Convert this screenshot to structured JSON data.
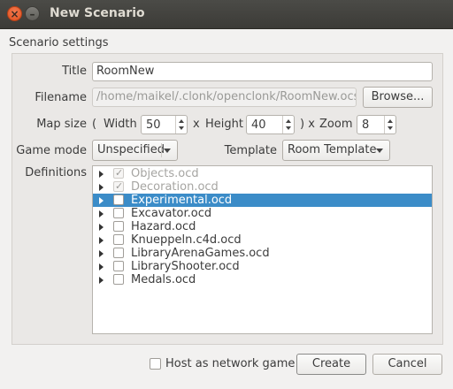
{
  "window": {
    "title": "New Scenario"
  },
  "group": {
    "label": "Scenario settings"
  },
  "form": {
    "title_label": "Title",
    "title_value": "RoomNew",
    "filename_label": "Filename",
    "filename_value": "/home/maikel/.clonk/openclonk/RoomNew.ocs",
    "browse_label": "Browse...",
    "mapsize_label": "Map size",
    "paren_open": "(",
    "width_label": "Width",
    "width_value": "50",
    "x_label": "x",
    "height_label": "Height",
    "height_value": "40",
    "paren_close_x": ") x",
    "zoom_label": "Zoom",
    "zoom_value": "8",
    "gamemode_label": "Game mode",
    "gamemode_value": "Unspecified",
    "template_label": "Template",
    "template_value": "Room Template",
    "definitions_label": "Definitions"
  },
  "definitions": [
    {
      "label": "Objects.ocd",
      "checked": true,
      "disabled": true,
      "selected": false
    },
    {
      "label": "Decoration.ocd",
      "checked": true,
      "disabled": true,
      "selected": false
    },
    {
      "label": "Experimental.ocd",
      "checked": false,
      "disabled": false,
      "selected": true
    },
    {
      "label": "Excavator.ocd",
      "checked": false,
      "disabled": false,
      "selected": false
    },
    {
      "label": "Hazard.ocd",
      "checked": false,
      "disabled": false,
      "selected": false
    },
    {
      "label": "Knueppeln.c4d.ocd",
      "checked": false,
      "disabled": false,
      "selected": false
    },
    {
      "label": "LibraryArenaGames.ocd",
      "checked": false,
      "disabled": false,
      "selected": false
    },
    {
      "label": "LibraryShooter.ocd",
      "checked": false,
      "disabled": false,
      "selected": false
    },
    {
      "label": "Medals.ocd",
      "checked": false,
      "disabled": false,
      "selected": false
    }
  ],
  "footer": {
    "host_label": "Host as network game",
    "host_checked": false,
    "create_label": "Create",
    "cancel_label": "Cancel"
  },
  "colors": {
    "selection": "#3b8cc8",
    "titlebar": "#3c3b37",
    "close": "#e0501f"
  }
}
